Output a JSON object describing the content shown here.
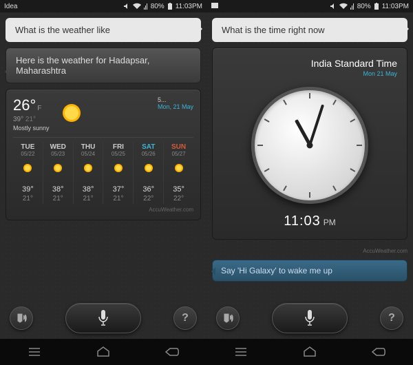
{
  "left": {
    "statusbar": {
      "carrier": "Idea",
      "battery": "80%",
      "time": "11:03PM"
    },
    "user_msg": "What is the weather like",
    "assistant_msg": "Here is the weather for Hadapsar, Maharashtra",
    "weather": {
      "temp": "26°",
      "unit": "F",
      "high": "39°",
      "low": "21°",
      "condition": "Mostly sunny",
      "location": "5...",
      "date": "Mon, 21 May",
      "forecast": [
        {
          "day": "TUE",
          "date": "05/22",
          "hi": "39°",
          "lo": "21°",
          "cls": ""
        },
        {
          "day": "WED",
          "date": "05/23",
          "hi": "38°",
          "lo": "21°",
          "cls": ""
        },
        {
          "day": "THU",
          "date": "05/24",
          "hi": "38°",
          "lo": "21°",
          "cls": ""
        },
        {
          "day": "FRI",
          "date": "05/25",
          "hi": "37°",
          "lo": "21°",
          "cls": ""
        },
        {
          "day": "SAT",
          "date": "05/26",
          "hi": "36°",
          "lo": "22°",
          "cls": "sat"
        },
        {
          "day": "SUN",
          "date": "05/27",
          "hi": "35°",
          "lo": "22°",
          "cls": "sun"
        }
      ],
      "attribution": "AccuWeather.com"
    }
  },
  "right": {
    "statusbar": {
      "carrier": "",
      "battery": "80%",
      "time": "11:03PM"
    },
    "user_msg": "What is the time right now",
    "timecard": {
      "tz": "India Standard Time",
      "date": "Mon 21 May",
      "time": "11:03",
      "ampm": "PM",
      "attribution": "AccuWeather.com"
    },
    "hint": "Say 'Hi Galaxy' to wake me up"
  }
}
